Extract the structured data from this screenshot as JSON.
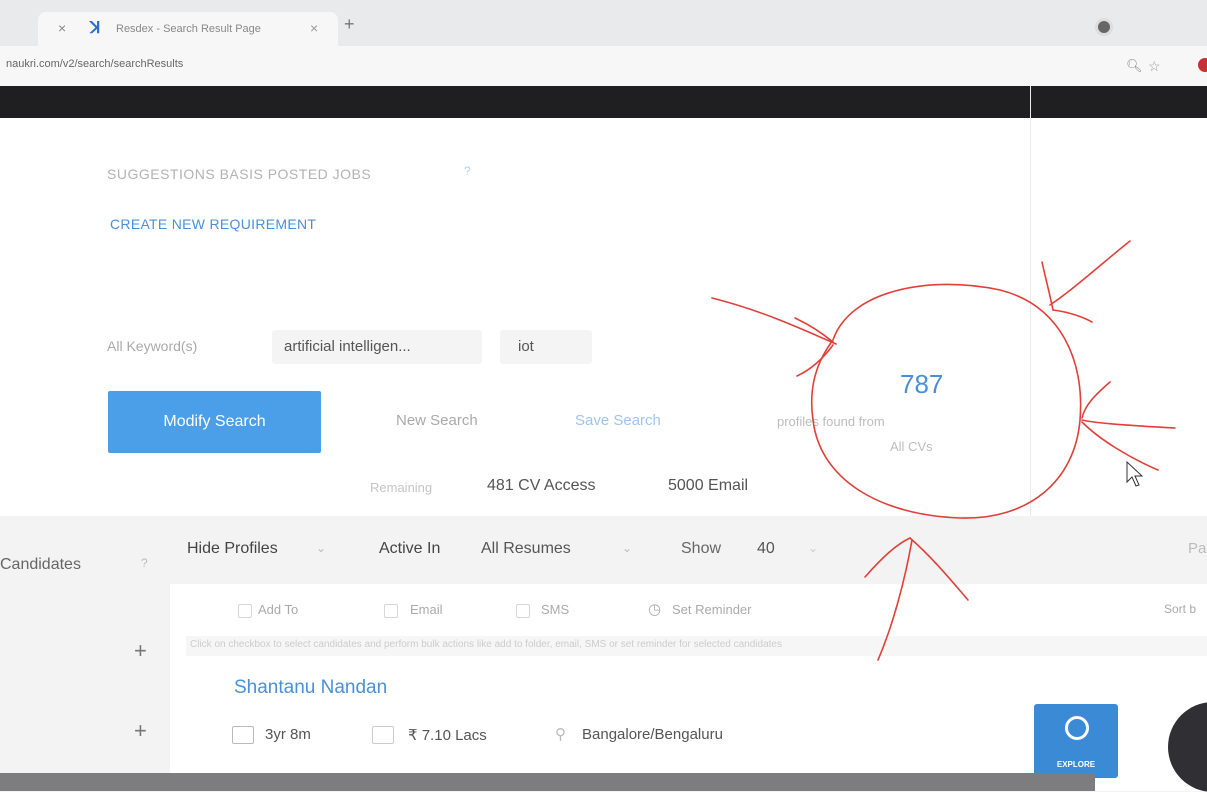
{
  "browser": {
    "tab_title": "Resdex - Search Result Page",
    "url": "naukri.com/v2/search/searchResults",
    "new_tab_symbol": "+",
    "close_symbol": "×"
  },
  "search_panel": {
    "suggestions_label": "SUGGESTIONS BASIS POSTED JOBS",
    "suggestions_help": "?",
    "create_requirement": "CREATE NEW REQUIREMENT",
    "keywords_label": "All Keyword(s)",
    "keywords": [
      "artificial intelligen...",
      "iot"
    ],
    "modify_search": "Modify Search",
    "new_search": "New Search",
    "save_search": "Save Search",
    "profile_count": "787",
    "profiles_found_text": "profiles found from",
    "profiles_source": "All CVs",
    "remaining_label": "Remaining",
    "cv_access": "481 CV Access",
    "email_quota": "5000 Email"
  },
  "results_toolbar": {
    "sidebar_label": "Candidates",
    "sidebar_help": "?",
    "hide_profiles": "Hide Profiles",
    "active_in_label": "Active In",
    "active_in_value": "All Resumes",
    "show_label": "Show",
    "show_value": "40",
    "page_label": "Pa",
    "actions": [
      "Add To",
      "Email",
      "SMS",
      "Set Reminder"
    ],
    "sort_label": "Sort b",
    "info_strip": "Click on checkbox to select candidates and perform bulk actions like add to folder, email, SMS or set reminder for selected candidates"
  },
  "candidate": {
    "name": "Shantanu Nandan",
    "experience": "3yr 8m",
    "salary": "₹ 7.10 Lacs",
    "location": "Bangalore/Bengaluru"
  },
  "explore_badge": "EXPLORE",
  "colors": {
    "accent": "#4a9fe8",
    "link": "#4a90d9",
    "nav_dark": "#1f1f22",
    "annotation": "#e0403a"
  },
  "icons": [
    "close-icon",
    "favicon",
    "new-tab-icon",
    "chrome-menu-icon",
    "zoom-icon",
    "bookmark-star-icon",
    "checkbox-icon",
    "clock-icon",
    "briefcase-icon",
    "wallet-icon",
    "location-pin-icon",
    "plus-icon",
    "compass-icon",
    "chevron-down-icon"
  ]
}
